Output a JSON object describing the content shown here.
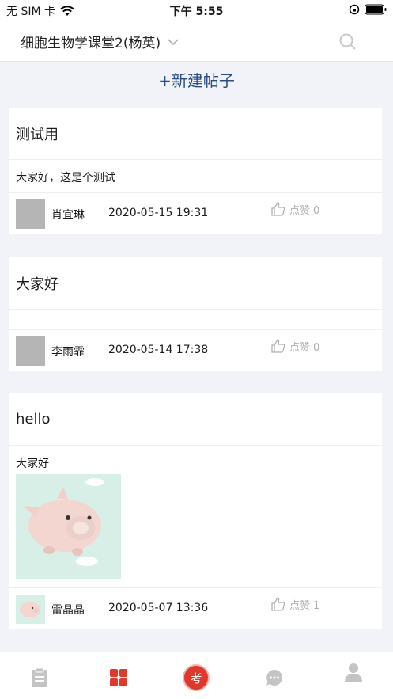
{
  "status_bar": {
    "carrier": "无 SIM 卡",
    "time": "下午 5:55"
  },
  "nav": {
    "title": "细胞生物学课堂2(杨英)",
    "search_icon": "search-icon",
    "dropdown_icon": "chevron-down-icon"
  },
  "new_post_label": "+新建帖子",
  "posts": [
    {
      "title": "测试用",
      "body": "大家好，这是个测试",
      "author": "肖宜琳",
      "date": "2020-05-15 19:31",
      "like_label": "点赞",
      "like_count": "0"
    },
    {
      "title": "大家好",
      "body": "",
      "author": "李雨霏",
      "date": "2020-05-14 17:38",
      "like_label": "点赞",
      "like_count": "0"
    },
    {
      "title": "hello",
      "body": "大家好",
      "author": "雷晶晶",
      "date": "2020-05-07 13:36",
      "like_label": "点赞",
      "like_count": "1"
    }
  ],
  "tab_bar": {
    "exam_label": "考",
    "tabs": [
      "clipboard-icon",
      "grid-icon",
      "exam-icon",
      "chat-icon",
      "person-icon"
    ]
  },
  "colors": {
    "accent": "#2a4d86",
    "active_tab": "#e0392b",
    "background": "#f2f3f8"
  }
}
